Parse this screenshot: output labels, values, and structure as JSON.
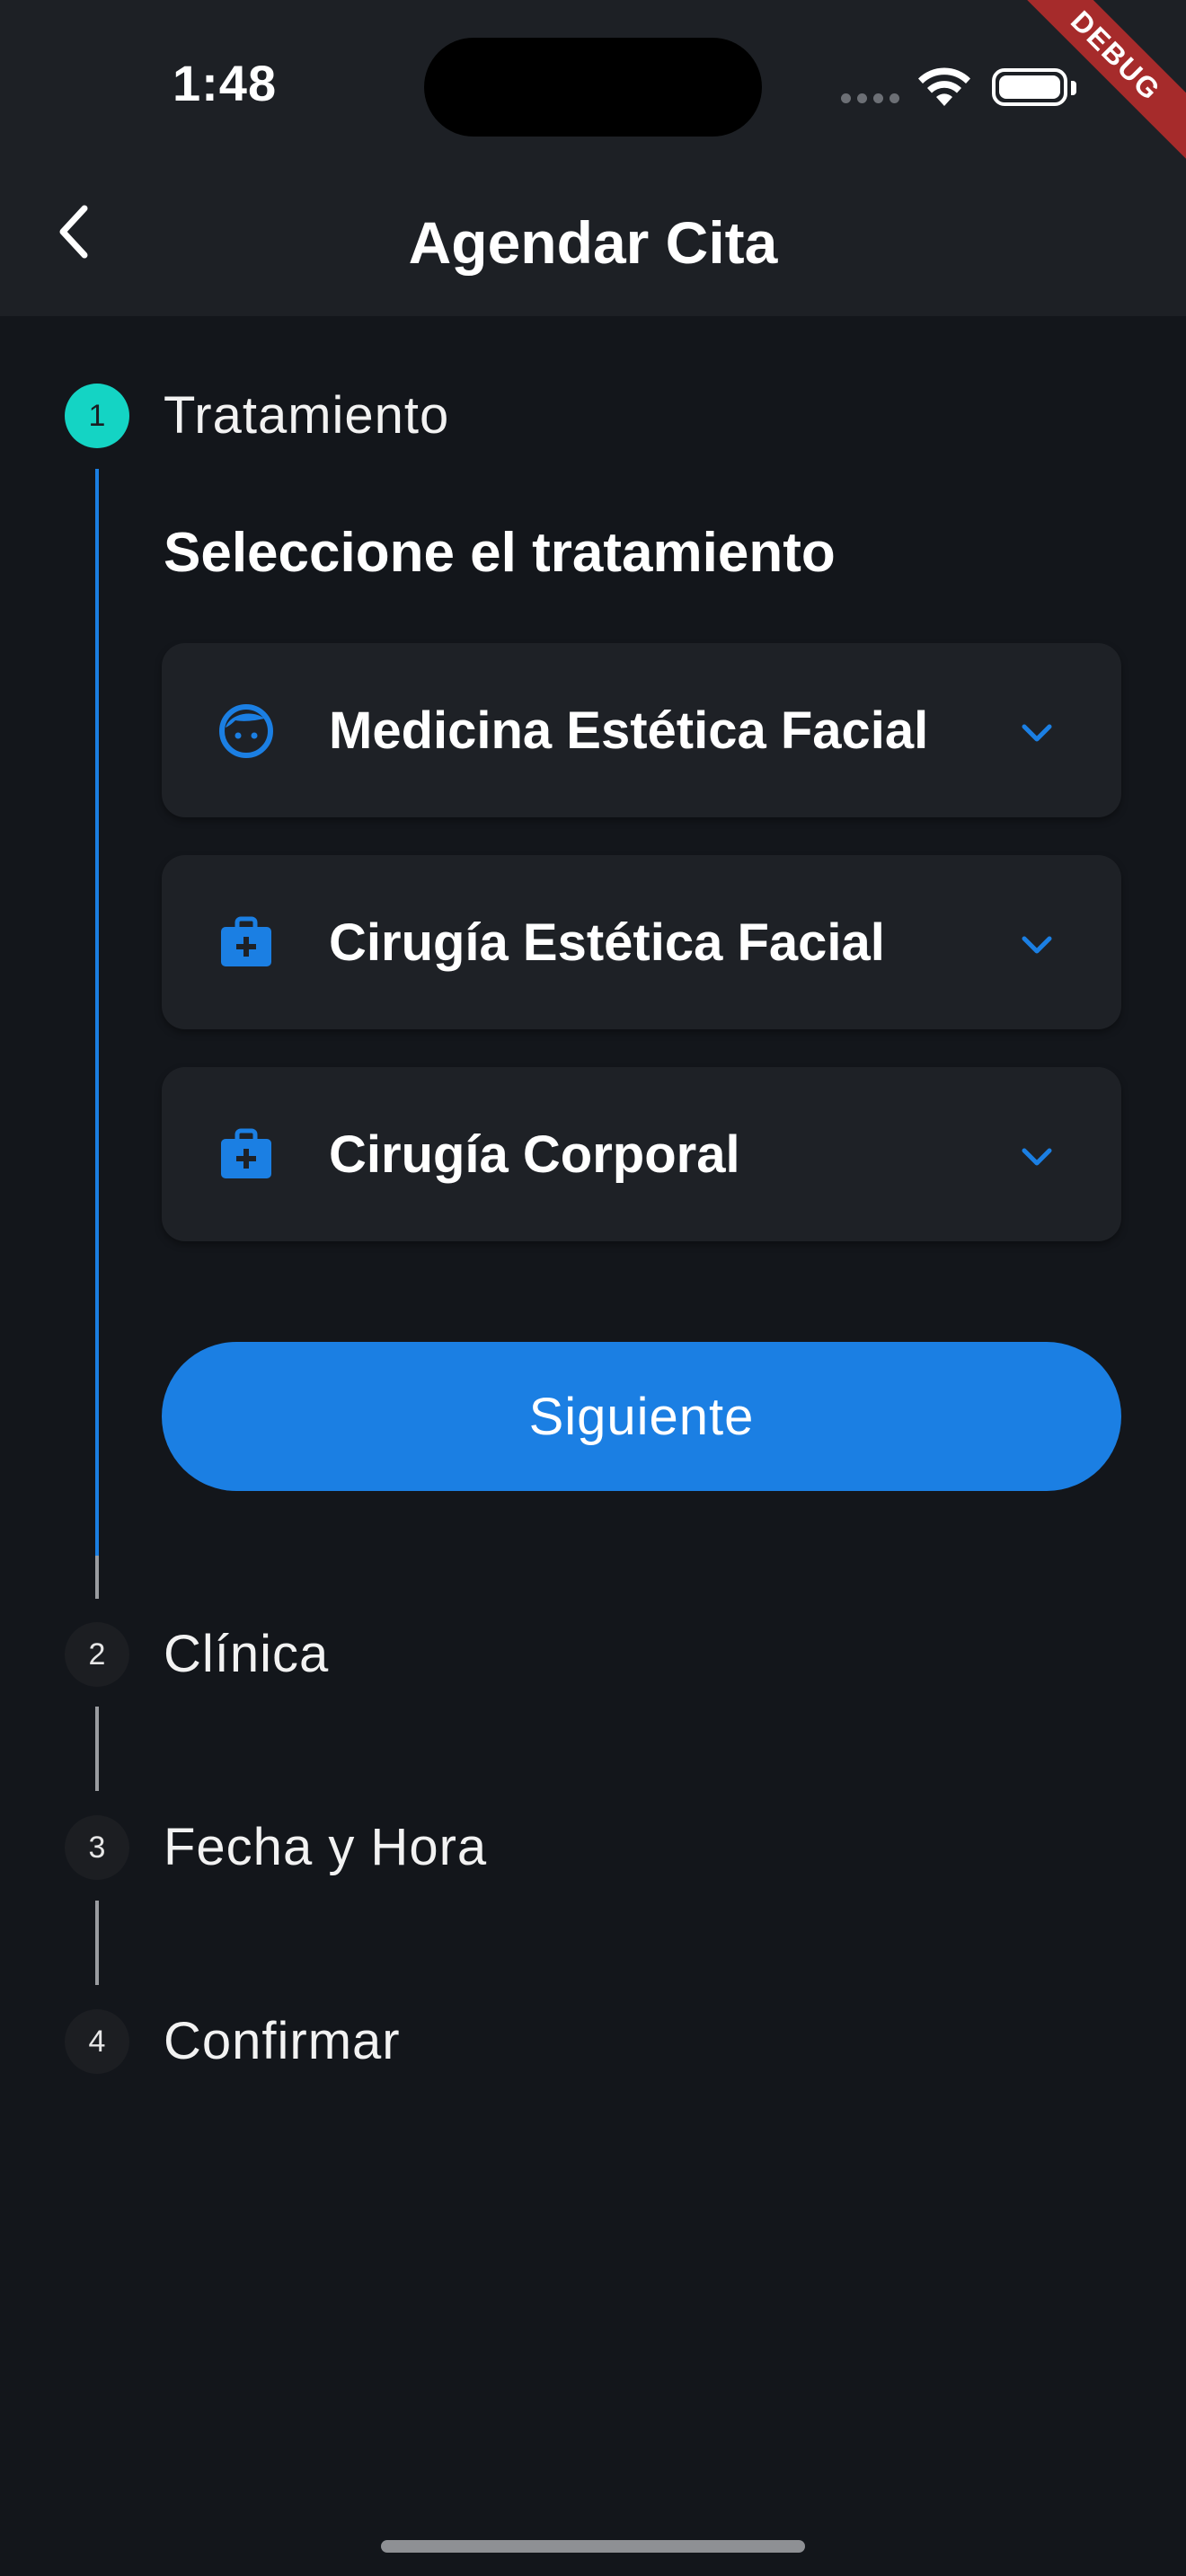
{
  "status_bar": {
    "time": "1:48",
    "debug_label": "DEBUG"
  },
  "header": {
    "title": "Agendar Cita",
    "back_icon": "chevron-left-icon"
  },
  "stepper": {
    "current_step": 1,
    "steps": [
      {
        "number": "1",
        "label": "Tratamiento",
        "state": "active"
      },
      {
        "number": "2",
        "label": "Clínica",
        "state": "inactive"
      },
      {
        "number": "3",
        "label": "Fecha y Hora",
        "state": "inactive"
      },
      {
        "number": "4",
        "label": "Confirmar",
        "state": "inactive"
      }
    ],
    "step1_content": {
      "section_title": "Seleccione el tratamiento",
      "options": [
        {
          "label": "Medicina Estética Facial",
          "icon": "face-icon"
        },
        {
          "label": "Cirugía Estética Facial",
          "icon": "medical-bag-icon"
        },
        {
          "label": "Cirugía Corporal",
          "icon": "medical-bag-icon"
        }
      ],
      "next_button": "Siguiente"
    }
  },
  "colors": {
    "background": "#13161b",
    "header_bg": "#1d2025",
    "accent_blue": "#1b7fe3",
    "active_step": "#14d4c4",
    "card_bg": "#1e2126"
  }
}
